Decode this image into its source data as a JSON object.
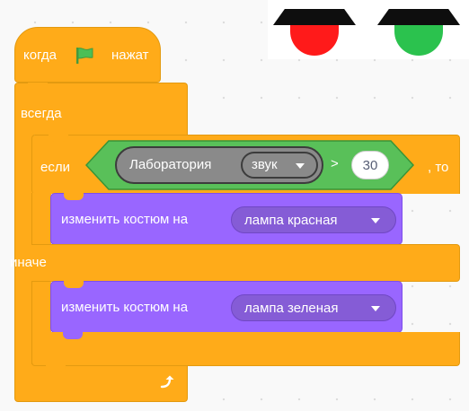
{
  "script": {
    "hat": {
      "when_label": "когда",
      "clicked_label": "нажат",
      "flag_icon": "green-flag-icon",
      "flag_color": "#4cbf56"
    },
    "forever": {
      "label": "всегда",
      "loop_icon": "loop-arrow-icon"
    },
    "if_else": {
      "if_label": "если",
      "then_label": ", то",
      "else_label": "иначе",
      "condition": {
        "operator": ">",
        "value": "30",
        "reporter": {
          "label": "Лаборатория",
          "dropdown": "звук"
        }
      }
    },
    "costume_red": {
      "label": "изменить костюм на",
      "dropdown": "лампа красная"
    },
    "costume_green": {
      "label": "изменить костюм на",
      "dropdown": "лампа зеленая"
    }
  },
  "colors": {
    "events": "#ffab19",
    "control": "#ffab19",
    "looks": "#9966ff",
    "operators": "#59c059",
    "sensing_extension": "#8a8a8a"
  },
  "stage": {
    "lamps": [
      {
        "name": "red-lamp",
        "color": "#ff1a1a"
      },
      {
        "name": "green-lamp",
        "color": "#2bc24e"
      }
    ]
  }
}
